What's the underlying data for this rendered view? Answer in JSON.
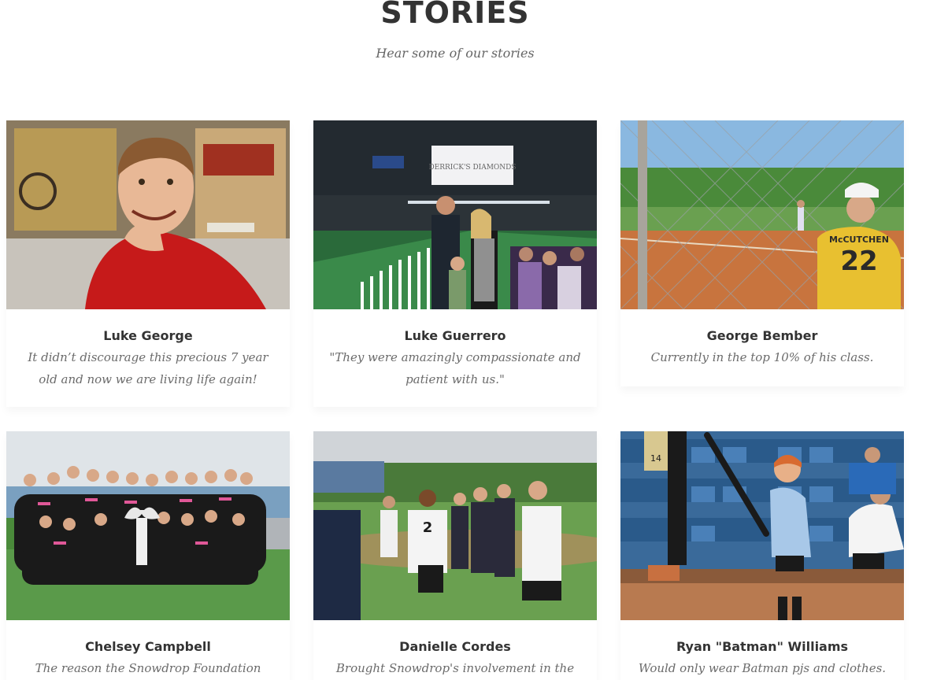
{
  "section": {
    "title": "STORIES",
    "subtitle": "Hear some of our stories"
  },
  "stories": [
    {
      "name": "Luke George",
      "quote": "It didn’t discourage this precious 7 year old and now we are living life again!",
      "photo": "boy-red-shirt-photo"
    },
    {
      "name": "Luke Guerrero",
      "quote": "\"They were amazingly compassionate and patient with us.\"",
      "photo": "stadium-event-photo"
    },
    {
      "name": "George Bember",
      "quote": "Currently in the top 10% of his class.",
      "photo": "baseball-fence-photo"
    },
    {
      "name": "Chelsey Campbell",
      "quote": "The reason the Snowdrop Foundation",
      "photo": "team-group-photo"
    },
    {
      "name": "Danielle Cordes",
      "quote": "Brought Snowdrop's involvement in the",
      "photo": "softball-players-photo"
    },
    {
      "name": "Ryan \"Batman\" Williams",
      "quote": "Would only wear Batman pjs and clothes.",
      "photo": "boy-with-bat-photo"
    }
  ],
  "photo_text": {
    "stadium_screen": "DERRICK'S DIAMONDS",
    "jersey_name": "McCUTCHEN",
    "jersey_number": "22",
    "player_number": "2",
    "wall_number": "14"
  },
  "colors": {
    "title": "#333333",
    "subtitle": "#666666",
    "name": "#333333",
    "quote": "#6b6b6b"
  }
}
